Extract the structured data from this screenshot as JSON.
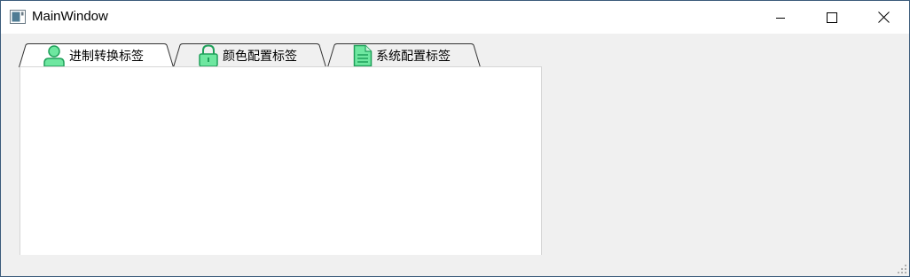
{
  "window": {
    "title": "MainWindow"
  },
  "tabs": [
    {
      "label": "进制转换标签",
      "icon": "user-icon",
      "selected": true
    },
    {
      "label": "颜色配置标签",
      "icon": "lock-icon",
      "selected": false
    },
    {
      "label": "系统配置标签",
      "icon": "document-icon",
      "selected": false
    }
  ],
  "colors": {
    "icon_green": "#2ecc71",
    "icon_stroke": "#1fa05a",
    "window_border": "#3a5a7a"
  }
}
